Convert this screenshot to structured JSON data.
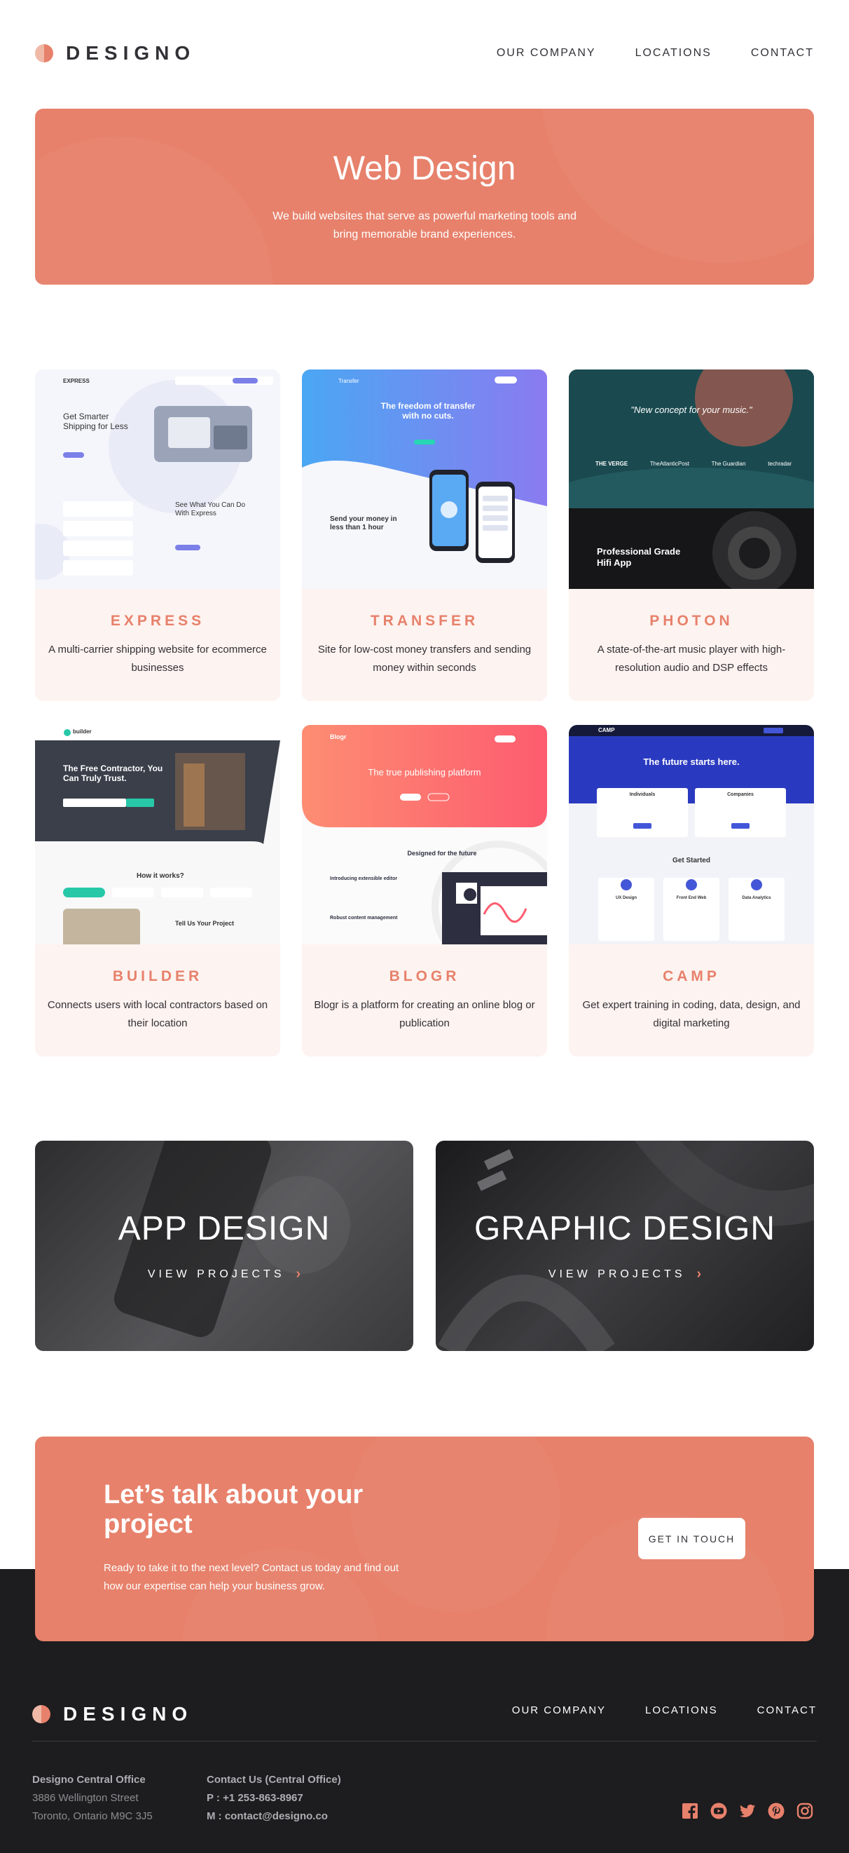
{
  "brand": {
    "name": "DESIGNO",
    "accent": "#e7816b",
    "dark": "#1d1c1e"
  },
  "nav": {
    "items": [
      "OUR COMPANY",
      "LOCATIONS",
      "CONTACT"
    ]
  },
  "hero": {
    "title": "Web Design",
    "text": "We build websites that serve as powerful marketing tools and bring memorable brand experiences."
  },
  "projects": [
    {
      "title": "EXPRESS",
      "desc": "A multi-carrier shipping website for ecommerce businesses",
      "thumb": {
        "brand": "EXPRESS",
        "headline": "Get Smarter Shipping for Less",
        "sub": "See What You Can Do With Express"
      }
    },
    {
      "title": "TRANSFER",
      "desc": "Site for low-cost money transfers and sending money within seconds",
      "thumb": {
        "brand": "Transfer",
        "headline": "The freedom of transfer with no cuts.",
        "sub": "Send your money in less than 1 hour"
      }
    },
    {
      "title": "PHOTON",
      "desc": "A state-of-the-art music player with high-resolution audio and DSP effects",
      "thumb": {
        "headline": "\"New concept for your music.\"",
        "sub": "Professional Grade Hifi App",
        "logos": [
          "THE VERGE",
          "TheAtlanticPost",
          "The Guardian",
          "techradar"
        ]
      }
    },
    {
      "title": "BUILDER",
      "desc": "Connects users with local contractors based on their location",
      "thumb": {
        "brand": "builder",
        "headline": "The Free Contractor, You Can Truly Trust.",
        "sub": "How it works?",
        "sub2": "Tell Us Your Project"
      }
    },
    {
      "title": "BLOGR",
      "desc": "Blogr is a platform for creating an online blog or publication",
      "thumb": {
        "brand": "Blogr",
        "headline": "The true publishing platform",
        "sub": "Designed for the future",
        "sub2": "Introducing extensible editor",
        "sub3": "Robust content management"
      }
    },
    {
      "title": "CAMP",
      "desc": "Get expert training in coding, data, design, and digital marketing",
      "thumb": {
        "brand": "CAMP",
        "headline": "The future starts here.",
        "sub": "Get Started",
        "cols": [
          "Individuals",
          "Companies"
        ],
        "tracks": [
          "UX Design",
          "Front End Web",
          "Data Analytics"
        ]
      }
    }
  ],
  "categories": [
    {
      "title": "APP DESIGN",
      "link": "VIEW PROJECTS"
    },
    {
      "title": "GRAPHIC DESIGN",
      "link": "VIEW PROJECTS"
    }
  ],
  "cta": {
    "title": "Let’s talk about your project",
    "text": "Ready to take it to the next level? Contact us today and find out how our expertise can help your business grow.",
    "button": "GET IN TOUCH"
  },
  "footer": {
    "office_title": "Designo Central Office",
    "address1": "3886 Wellington Street",
    "address2": "Toronto, Ontario M9C 3J5",
    "contact_title": "Contact Us (Central Office)",
    "phone": "P : +1 253-863-8967",
    "email": "M : contact@designo.co",
    "socials": [
      "facebook-icon",
      "youtube-icon",
      "twitter-icon",
      "pinterest-icon",
      "instagram-icon"
    ]
  }
}
